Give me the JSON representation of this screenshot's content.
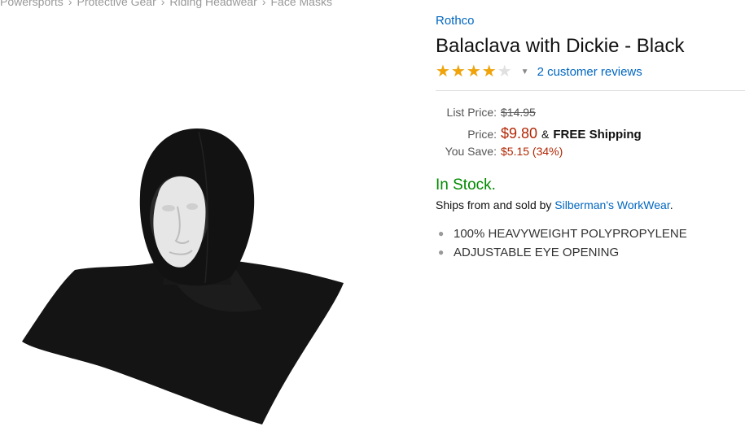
{
  "breadcrumb": {
    "items": [
      "Powersports",
      "Protective Gear",
      "Riding Headwear",
      "Face Masks"
    ],
    "separator": "›"
  },
  "product": {
    "brand": "Rothco",
    "title": "Balaclava with Dickie - Black",
    "rating": {
      "value": 4,
      "max": 5,
      "reviews_link": "2 customer reviews"
    },
    "price": {
      "list_label": "List Price:",
      "list_value": "$14.95",
      "price_label": "Price:",
      "price_value": "$9.80",
      "amp": "&",
      "shipping": "FREE Shipping",
      "save_label": "You Save:",
      "save_value": "$5.15 (34%)"
    },
    "availability": "In Stock.",
    "ships_prefix": "Ships from and sold by",
    "seller": "Silberman's WorkWear",
    "ships_suffix": ".",
    "features": [
      "100% HEAVYWEIGHT POLYPROPYLENE",
      "ADJUSTABLE EYE OPENING"
    ],
    "image_icon": "balaclava-product-image"
  },
  "colors": {
    "link": "#0066c0",
    "price": "#b12704",
    "in_stock": "#008a00",
    "star": "#f0a40a"
  }
}
